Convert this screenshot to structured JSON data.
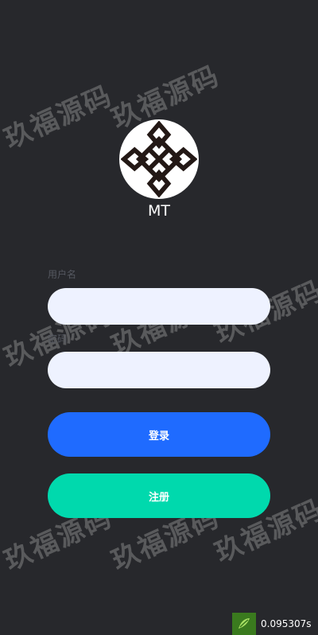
{
  "app": {
    "name": "MT",
    "logo_icon": "knot-cross-logo"
  },
  "form": {
    "username_label": "用户名",
    "username_value": "",
    "password_label": "密码",
    "password_value": ""
  },
  "buttons": {
    "login_label": "登录",
    "register_label": "注册"
  },
  "watermark": {
    "text": "玖福源码"
  },
  "timer": {
    "icon": "leaf-logo-icon",
    "value": "0.095307s"
  },
  "colors": {
    "background": "#27282c",
    "input_bg": "#eef2ff",
    "login_button": "#1f6bff",
    "register_button": "#00d9ad"
  }
}
